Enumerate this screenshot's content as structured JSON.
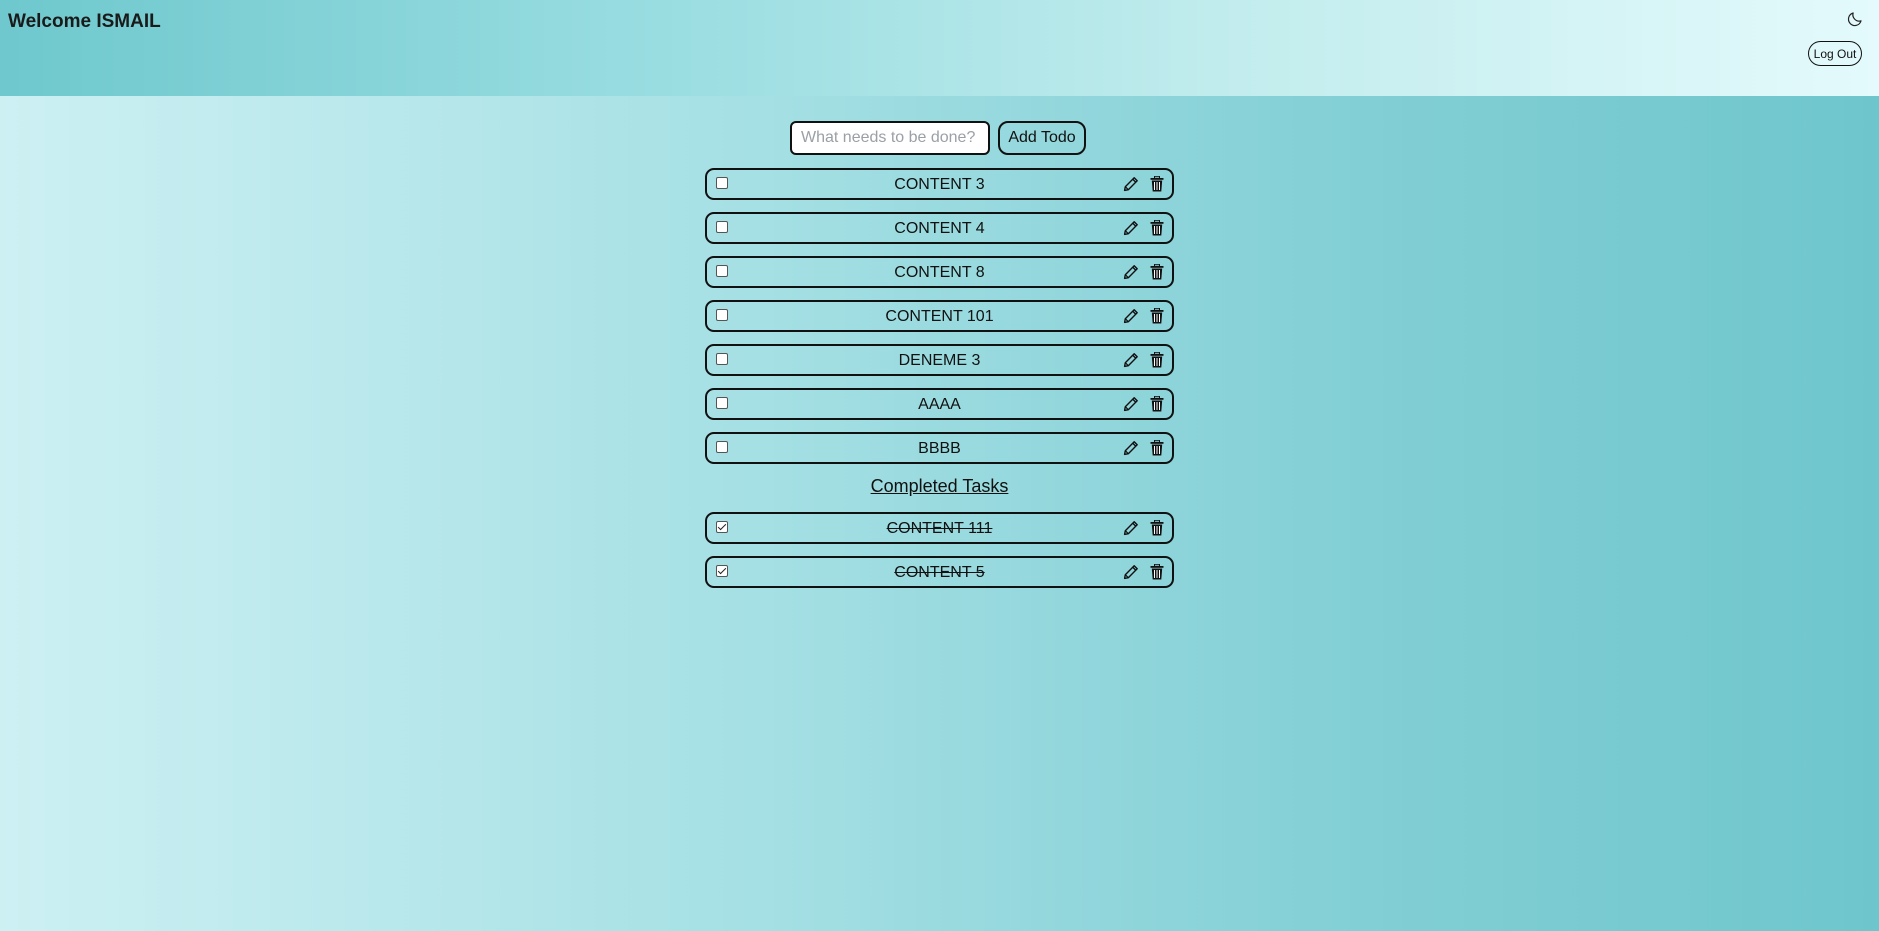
{
  "header": {
    "welcome": "Welcome ISMAIL",
    "theme_toggle_icon": "moon-icon",
    "logout_label": "Log Out"
  },
  "add_todo": {
    "placeholder": "What needs to be done?",
    "value": "",
    "button_label": "Add Todo"
  },
  "pending": [
    {
      "text": "CONTENT 3",
      "checked": false
    },
    {
      "text": "CONTENT 4",
      "checked": false
    },
    {
      "text": "CONTENT 8",
      "checked": false
    },
    {
      "text": "CONTENT 101",
      "checked": false
    },
    {
      "text": "DENEME 3",
      "checked": false
    },
    {
      "text": "AAAA",
      "checked": false
    },
    {
      "text": "BBBB",
      "checked": false
    }
  ],
  "completed_title": "Completed Tasks",
  "completed": [
    {
      "text": "CONTENT 111",
      "checked": true
    },
    {
      "text": "CONTENT 5",
      "checked": true
    }
  ],
  "icons": {
    "edit": "pencil-icon",
    "delete": "trash-icon"
  },
  "colors": {
    "border": "#111111",
    "header_left": "#6ec8cd",
    "header_right": "#e4fafc",
    "body_left": "#cdf0f3",
    "body_right": "#6ec6cc"
  }
}
